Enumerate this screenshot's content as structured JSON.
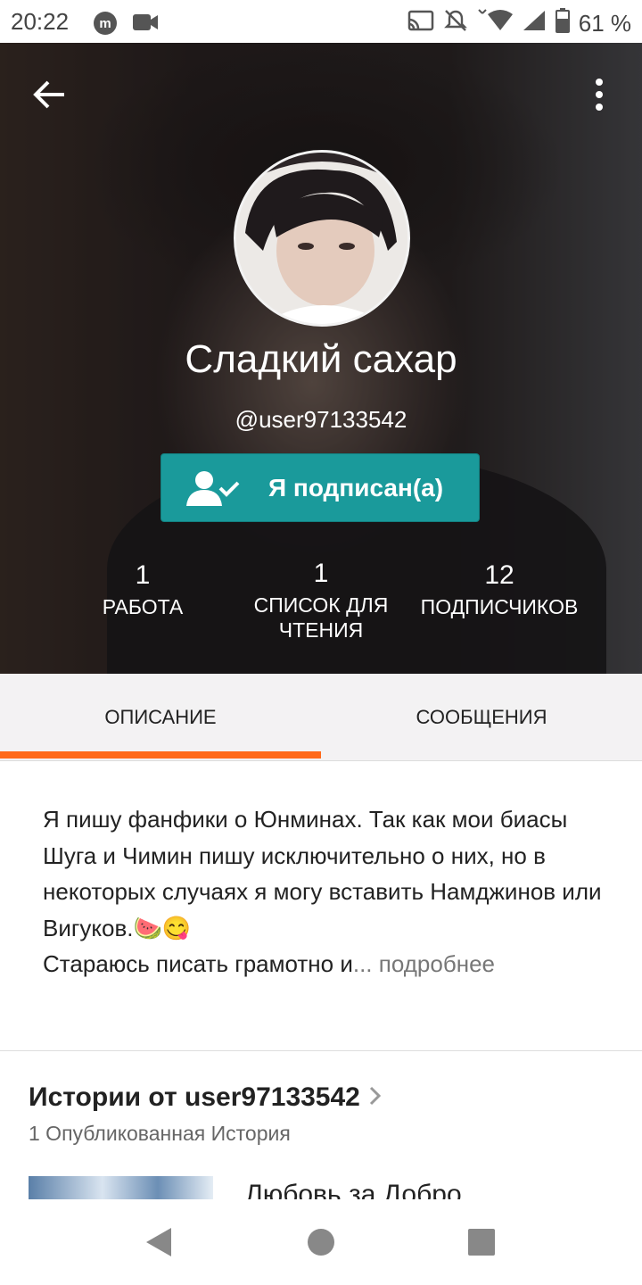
{
  "status_bar": {
    "time": "20:22",
    "battery": "61 %",
    "icons": [
      "m-app-icon",
      "video-camera-icon",
      "cast-icon",
      "mute-icon",
      "wifi-icon",
      "signal-icon",
      "battery-icon"
    ]
  },
  "profile": {
    "display_name": "Сладкий сахар",
    "username": "@user97133542",
    "follow_button": "Я подписан(а)",
    "stats": [
      {
        "value": "1",
        "label": "РАБОТА"
      },
      {
        "value": "1",
        "label": "СПИСОК ДЛЯ ЧТЕНИЯ"
      },
      {
        "value": "12",
        "label": "ПОДПИСЧИКОВ"
      }
    ]
  },
  "tabs": [
    {
      "label": "ОПИСАНИЕ",
      "active": true
    },
    {
      "label": "СООБЩЕНИЯ",
      "active": false
    }
  ],
  "about": {
    "text": "Я пишу фанфики о Юнминах. Так как мои биасы Шуга и Чимин пишу исключительно о них, но в некоторых случаях я могу вставить Намджинов или Вигуков.🍉😋\nСтараюсь писать грамотно и",
    "more": "... подробнее"
  },
  "stories": {
    "title": "Истории от user97133542",
    "subtitle": "1 Опубликованная История",
    "items": [
      {
        "title": "Любовь за Добро"
      }
    ]
  },
  "colors": {
    "accent": "#ff6a1a",
    "follow_button": "#1a9a9b"
  }
}
